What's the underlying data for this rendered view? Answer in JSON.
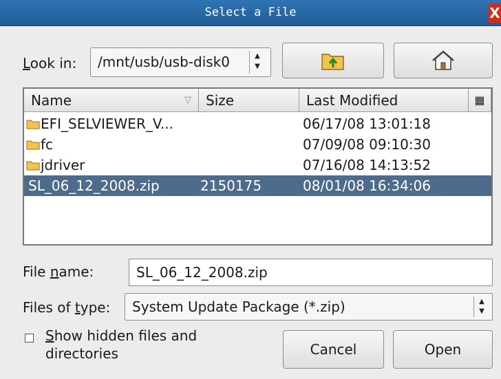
{
  "window": {
    "title": "Select a File",
    "close_label": "X"
  },
  "look_in": {
    "label_u": "L",
    "label_rest": "ook in:",
    "value": "/mnt/usb/usb-disk0",
    "spin_up": "▲",
    "spin_down": "▼",
    "up_button_icon": "folder-up-icon",
    "home_button_icon": "home-icon"
  },
  "columns": {
    "name": "Name",
    "size": "Size",
    "modified": "Last Modified",
    "sort_glyph": "▽",
    "options_glyph": "▦"
  },
  "files": [
    {
      "name": "EFI_SELVIEWER_V...",
      "size": "",
      "modified": "06/17/08 13:01:18",
      "is_folder": true,
      "selected": false
    },
    {
      "name": "fc",
      "size": "",
      "modified": "07/09/08 09:10:30",
      "is_folder": true,
      "selected": false
    },
    {
      "name": "jdriver",
      "size": "",
      "modified": "07/16/08 14:13:52",
      "is_folder": true,
      "selected": false
    },
    {
      "name": "SL_06_12_2008.zip",
      "size": "2150175",
      "modified": "08/01/08 16:34:06",
      "is_folder": false,
      "selected": true
    }
  ],
  "file_name": {
    "label_pre": "File ",
    "label_u": "n",
    "label_post": "ame:",
    "value": "SL_06_12_2008.zip"
  },
  "file_type": {
    "label_pre": "Files of ",
    "label_u": "t",
    "label_post": "ype:",
    "value": "System Update Package (*.zip)",
    "spin_up": "▲",
    "spin_down": "▼"
  },
  "show_hidden": {
    "u": "S",
    "line1_rest": "how hidden files and",
    "line2": "directories",
    "checked": false
  },
  "buttons": {
    "cancel": "Cancel",
    "open": "Open"
  },
  "colors": {
    "titlebar": "#2a6aa8",
    "selection": "#4d6b8c",
    "close": "#d62a1c",
    "folder": "#f2c14e"
  }
}
